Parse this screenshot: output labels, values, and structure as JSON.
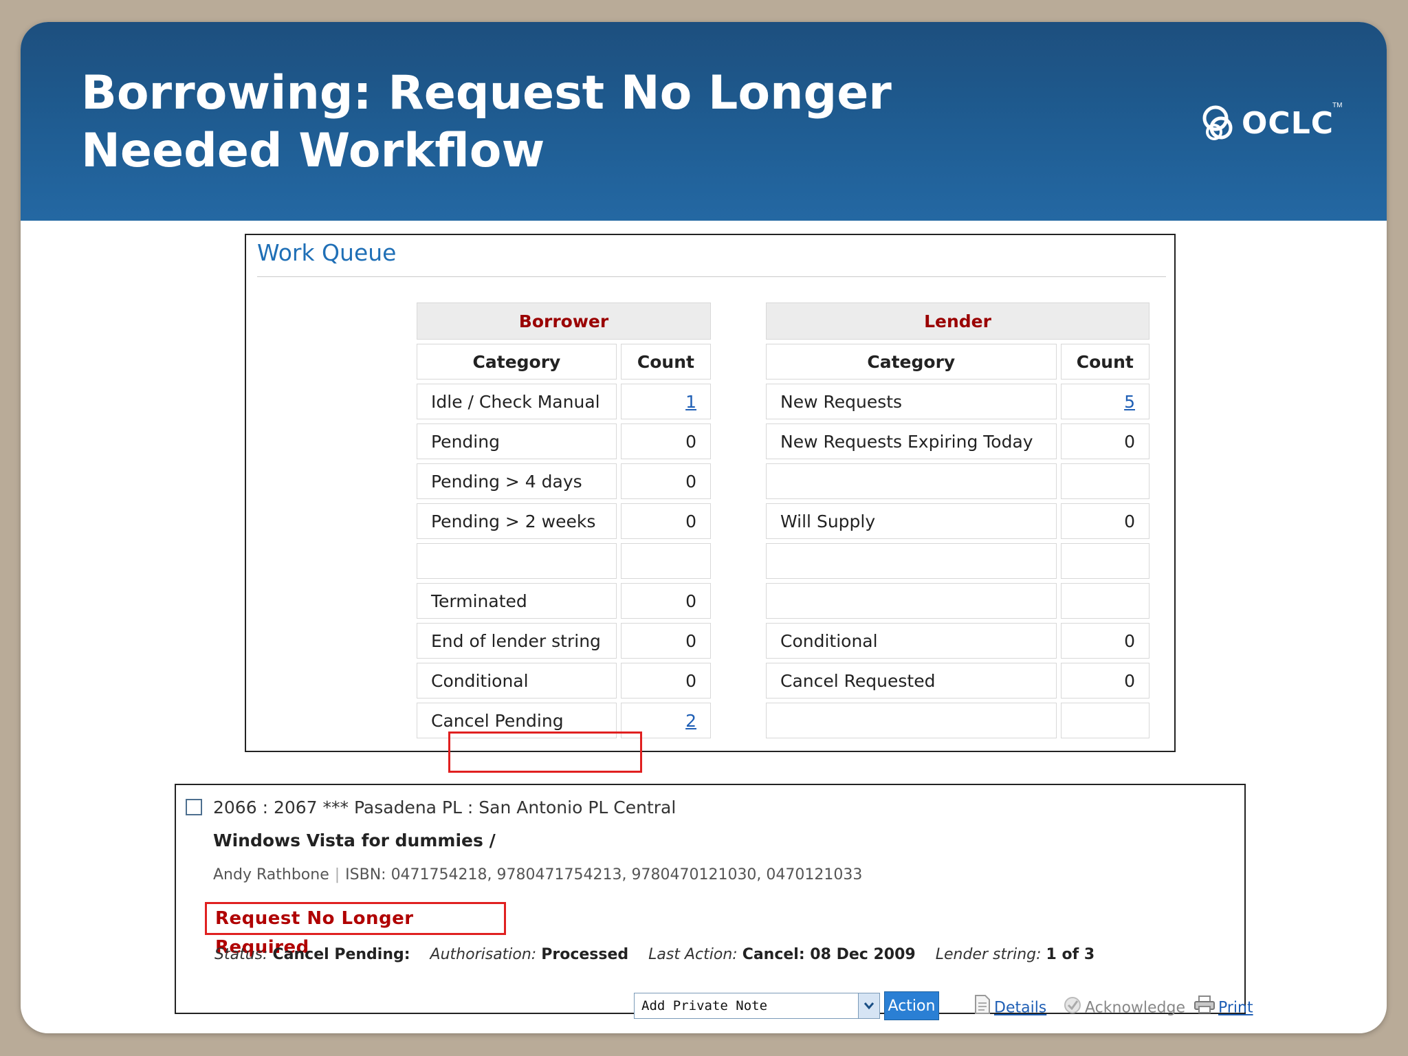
{
  "slide": {
    "title": "Borrowing: Request No Longer Needed Workflow",
    "logo_text": "OCLC",
    "logo_tm": "TM"
  },
  "work_queue": {
    "title": "Work Queue",
    "borrower": {
      "heading": "Borrower",
      "col_category": "Category",
      "col_count": "Count",
      "rows": [
        {
          "category": "Idle / Check Manual",
          "count": "1",
          "link": true
        },
        {
          "category": "Pending",
          "count": "0"
        },
        {
          "category": "Pending > 4 days",
          "count": "0"
        },
        {
          "category": "Pending > 2 weeks",
          "count": "0"
        },
        {
          "category": "",
          "count": ""
        },
        {
          "category": "Terminated",
          "count": "0"
        },
        {
          "category": "End of lender string",
          "count": "0"
        },
        {
          "category": "Conditional",
          "count": "0"
        },
        {
          "category": "Cancel Pending",
          "count": "2",
          "link": true,
          "highlighted": true
        }
      ]
    },
    "lender": {
      "heading": "Lender",
      "col_category": "Category",
      "col_count": "Count",
      "rows": [
        {
          "category": "New Requests",
          "count": "5",
          "link": true
        },
        {
          "category": "New Requests Expiring Today",
          "count": "0"
        },
        {
          "category": "",
          "count": ""
        },
        {
          "category": "Will Supply",
          "count": "0"
        },
        {
          "category": "",
          "count": ""
        },
        {
          "category": "",
          "count": ""
        },
        {
          "category": "Conditional",
          "count": "0"
        },
        {
          "category": "Cancel Requested",
          "count": "0"
        },
        {
          "category": "",
          "count": ""
        }
      ]
    }
  },
  "record": {
    "line1": "2066 : 2067 *** Pasadena PL : San Antonio PL Central",
    "title": "Windows Vista for dummies /",
    "author": "Andy Rathbone",
    "separator": "|",
    "isbn": "ISBN: 0471754218, 9780471754213, 9780470121030, 0470121033",
    "notice": "Request No Longer Required",
    "status_label": "Status:",
    "status_value": "Cancel Pending:",
    "auth_label": "Authorisation:",
    "auth_value": "Processed",
    "last_action_label": "Last Action:",
    "last_action_value": "Cancel: 08 Dec 2009",
    "lender_string_label": "Lender string:",
    "lender_string_value": "1 of 3",
    "select_value": "Add Private Note",
    "action_label": "Action",
    "details_label": "Details",
    "acknowledge_label": "Acknowledge",
    "print_label": "Print"
  },
  "colors": {
    "banner": "#1f5d93",
    "heading_red": "#9a0000",
    "link_blue": "#1f5fb5",
    "highlight_red": "#e02020",
    "queue_title_blue": "#1f6fb6"
  }
}
